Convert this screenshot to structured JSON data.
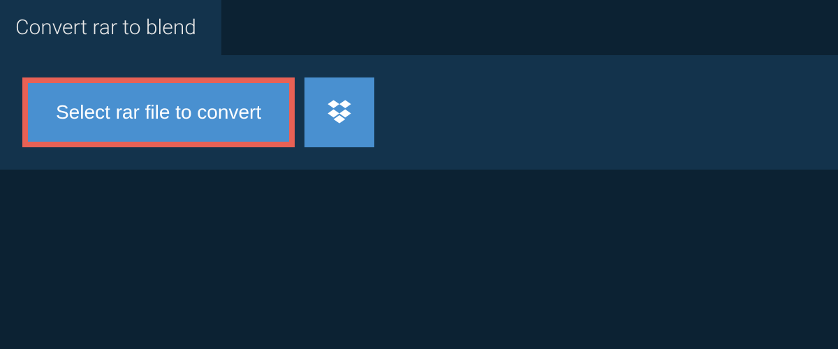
{
  "tab": {
    "title": "Convert rar to blend"
  },
  "actions": {
    "select_label": "Select rar file to convert"
  }
}
